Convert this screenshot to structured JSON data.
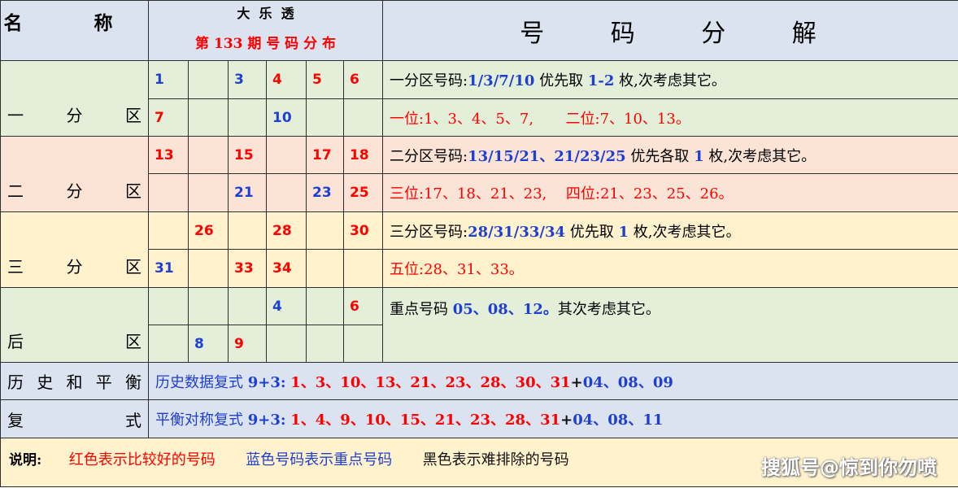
{
  "header": {
    "name_label": "名 称",
    "lottery_name": "大  乐  透",
    "period_title": "第 133 期 号 码 分 布",
    "breakdown_title": "号 码 分 解"
  },
  "zones": {
    "zone1": {
      "label": "一 分 区",
      "row1": [
        "1",
        "",
        "3",
        "4",
        "5",
        "6"
      ],
      "row2": [
        "7",
        "",
        "",
        "10",
        "",
        ""
      ],
      "info1_prefix": "一分区号码:",
      "info1_nums": "1/3/7/10",
      "info1_mid": "优先取",
      "info1_count": "1-2",
      "info1_suffix": "枚,次考虑其它。",
      "info2_a": "一位:1、3、4、5、7,",
      "info2_b": "二位:7、10、13。"
    },
    "zone2": {
      "label": "二 分 区",
      "row1": [
        "13",
        "",
        "15",
        "",
        "17",
        "18"
      ],
      "row2": [
        "",
        "",
        "21",
        "",
        "23",
        "25"
      ],
      "info1_prefix": "二分区号码:",
      "info1_nums": "13/15/21、21/23/25",
      "info1_mid": "优先各取",
      "info1_count": "1",
      "info1_suffix": "枚,次考虑其它。",
      "info2_a": "三位:17、18、21、23,",
      "info2_b": "四位:21、23、25、26。"
    },
    "zone3": {
      "label": "三 分 区",
      "row1": [
        "",
        "26",
        "",
        "28",
        "",
        "30"
      ],
      "row2": [
        "31",
        "",
        "33",
        "34",
        "",
        ""
      ],
      "info1_prefix": "三分区号码:",
      "info1_nums": "28/31/33/34",
      "info1_mid": "优先取",
      "info1_count": "1",
      "info1_suffix": "枚,次考虑其它。",
      "info2_a": "五位:28、31、33。"
    },
    "back": {
      "label": "后 区",
      "row1": [
        "",
        "",
        "",
        "4",
        "",
        "6"
      ],
      "row2": [
        "",
        "8",
        "9",
        "",
        "",
        ""
      ],
      "info_prefix": "重点号码",
      "info_nums": "05、08、12。",
      "info_suffix": "其次考虑其它。"
    }
  },
  "compound": {
    "label_line1": "历 史 和 平 衡",
    "label_line2": "复 式",
    "history_prefix": "历史数据复式",
    "history_formula": "9+3:",
    "history_front": "1、3、10、13、21、23、28、30、31",
    "history_plus": "+",
    "history_back": "04、08、09",
    "balance_prefix": "平衡对称复式",
    "balance_formula": "9+3:",
    "balance_front": "1、4、9、10、15、21、23、28、31",
    "balance_plus": "+",
    "balance_back": "04、08、11"
  },
  "legend": {
    "title": "说明:",
    "red_text": "红色表示比较好的号码",
    "blue_text": "蓝色号码表示重点号码",
    "black_text": "黑色表示难排除的号码"
  },
  "watermark": "搜狐号@惊到你勿喷",
  "colors": {
    "header_bg": "#dbe3f1",
    "zone1_bg": "#e3efd9",
    "zone2_bg": "#fbe3d6",
    "zone3_bg": "#fff2cc",
    "red": "#ff0000",
    "blue": "#1f3fd0"
  }
}
